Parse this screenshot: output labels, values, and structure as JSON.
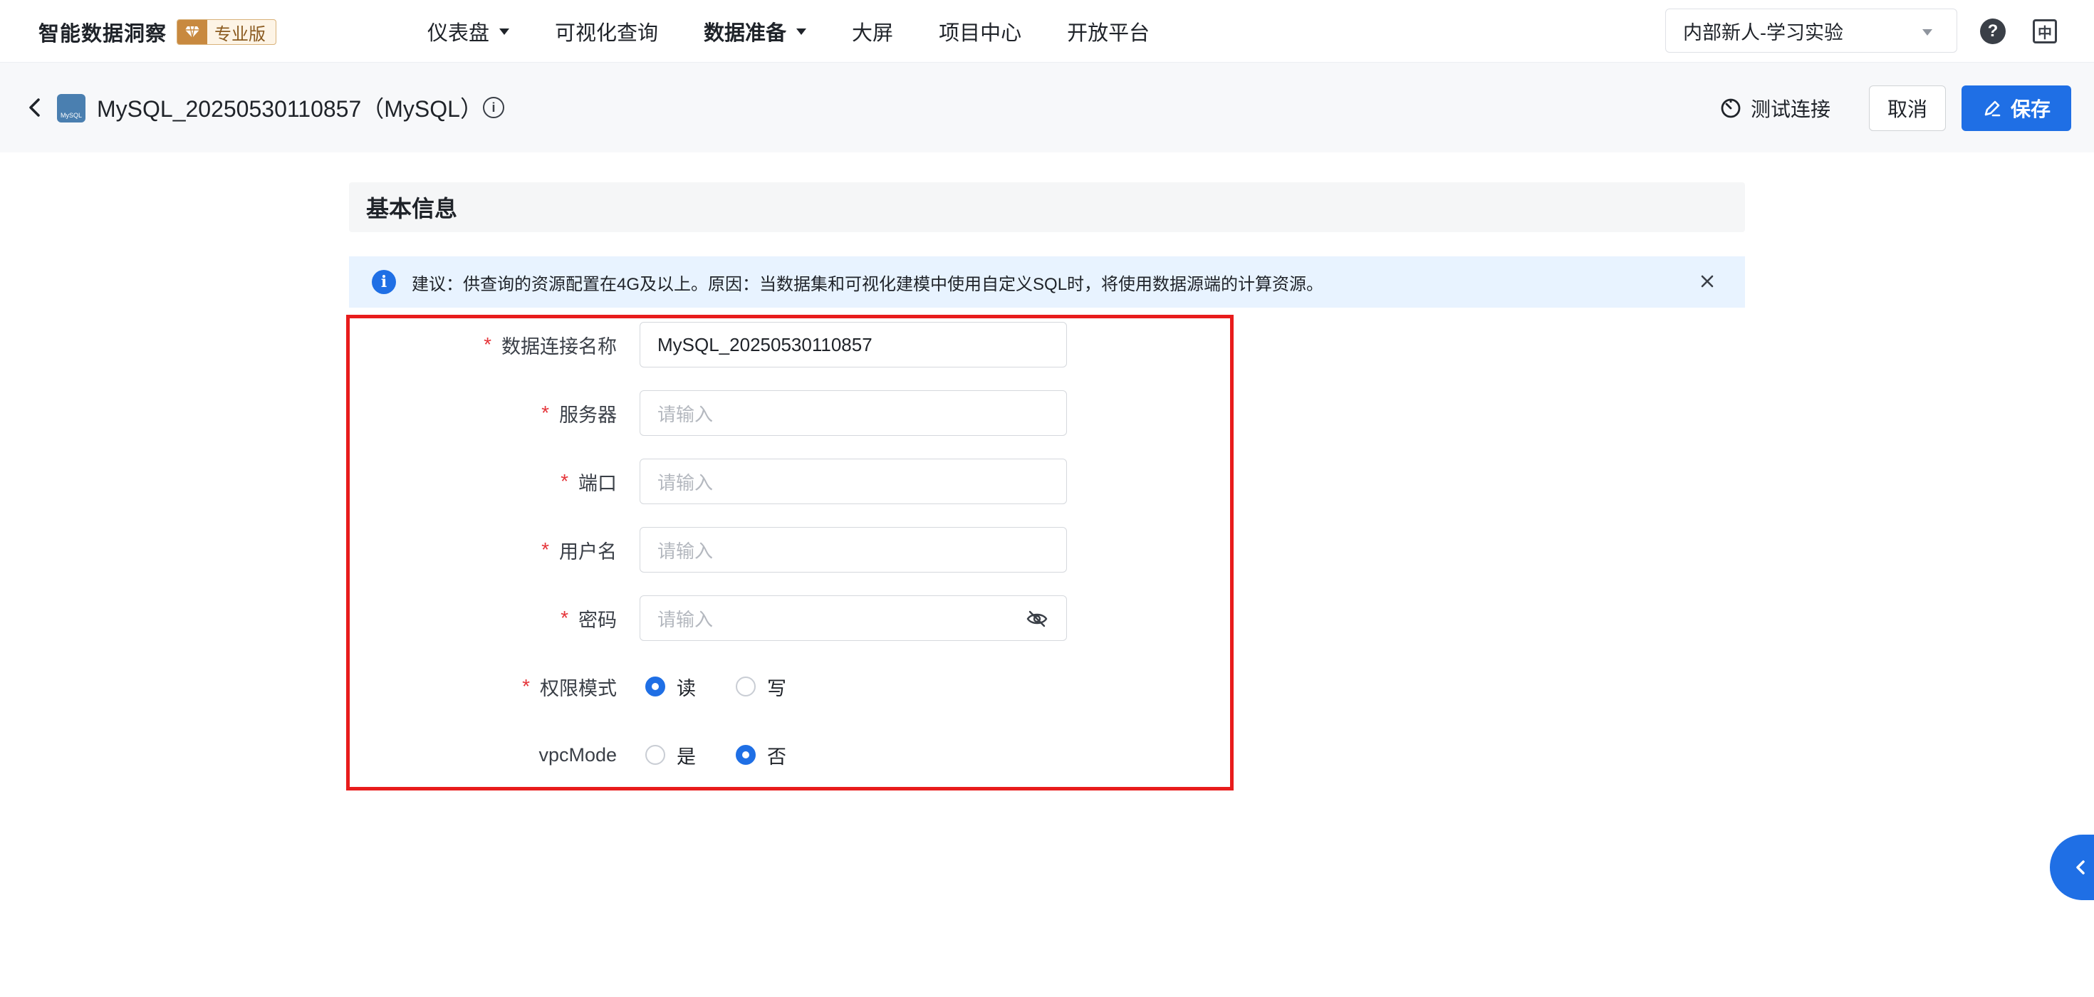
{
  "app": {
    "brand_name": "智能数据洞察",
    "edition": "专业版"
  },
  "nav": {
    "items": [
      {
        "label": "仪表盘",
        "has_dropdown": true,
        "active": false
      },
      {
        "label": "可视化查询",
        "has_dropdown": false,
        "active": false
      },
      {
        "label": "数据准备",
        "has_dropdown": true,
        "active": true
      },
      {
        "label": "大屏",
        "has_dropdown": false,
        "active": false
      },
      {
        "label": "项目中心",
        "has_dropdown": false,
        "active": false
      },
      {
        "label": "开放平台",
        "has_dropdown": false,
        "active": false
      }
    ],
    "project_selected": "内部新人-学习实验",
    "help_glyph": "?",
    "lang_glyph": "中"
  },
  "header": {
    "db_icon_text": "MySQL",
    "title": "MySQL_20250530110857（MySQL）",
    "info_glyph": "i",
    "test_connection_label": "测试连接",
    "cancel_label": "取消",
    "save_label": "保存"
  },
  "section": {
    "title": "基本信息",
    "notice_glyph": "i",
    "notice_text": "建议：供查询的资源配置在4G及以上。原因：当数据集和可视化建模中使用自定义SQL时，将使用数据源端的计算资源。"
  },
  "form": {
    "connection_name": {
      "label": "数据连接名称",
      "required": true,
      "value": "MySQL_20250530110857"
    },
    "server": {
      "label": "服务器",
      "required": true,
      "placeholder": "请输入"
    },
    "port": {
      "label": "端口",
      "required": true,
      "placeholder": "请输入"
    },
    "username": {
      "label": "用户名",
      "required": true,
      "placeholder": "请输入"
    },
    "password": {
      "label": "密码",
      "required": true,
      "placeholder": "请输入"
    },
    "permission_mode": {
      "label": "权限模式",
      "required": true,
      "options": [
        {
          "label": "读",
          "checked": true
        },
        {
          "label": "写",
          "checked": false
        }
      ]
    },
    "vpc_mode": {
      "label": "vpcMode",
      "required": false,
      "options": [
        {
          "label": "是",
          "checked": false
        },
        {
          "label": "否",
          "checked": true
        }
      ]
    }
  },
  "colors": {
    "primary": "#1f6fe5",
    "required_star": "#e5353a",
    "highlight_border": "#e81c1c",
    "notice_bg": "#e8f3ff"
  },
  "icons": [
    "back-chevron-icon",
    "mysql-db-icon",
    "info-icon",
    "timer-icon",
    "edit-pen-icon",
    "close-icon",
    "eye-off-icon",
    "help-icon",
    "language-icon",
    "collapse-chevron-icon"
  ]
}
